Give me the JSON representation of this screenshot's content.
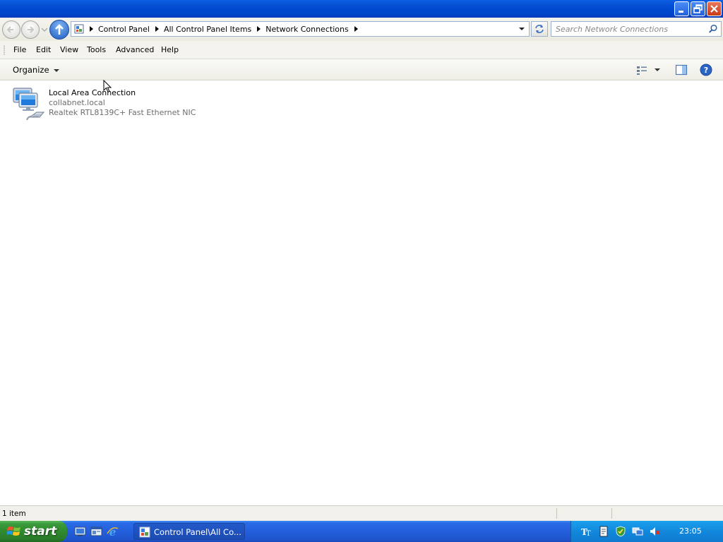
{
  "window": {
    "caption_buttons": [
      "minimize",
      "restore",
      "close"
    ]
  },
  "address": {
    "breadcrumbs": [
      "Control Panel",
      "All Control Panel Items",
      "Network Connections"
    ],
    "search_placeholder": "Search Network Connections"
  },
  "menu": {
    "items": [
      "File",
      "Edit",
      "View",
      "Tools",
      "Advanced",
      "Help"
    ]
  },
  "toolbar": {
    "organize_label": "Organize"
  },
  "connections": [
    {
      "name": "Local Area Connection",
      "domain": "collabnet.local",
      "adapter": "Realtek RTL8139C+ Fast Ethernet NIC"
    }
  ],
  "status": {
    "item_count": "1 item"
  },
  "taskbar": {
    "start_label": "start",
    "task_label": "Control Panel\\All Co...",
    "clock": "23:05"
  },
  "colors": {
    "titlebar": "#0a55d8",
    "taskbar": "#245fdc",
    "start_button": "#3a9a3a",
    "tray": "#1288dc"
  }
}
